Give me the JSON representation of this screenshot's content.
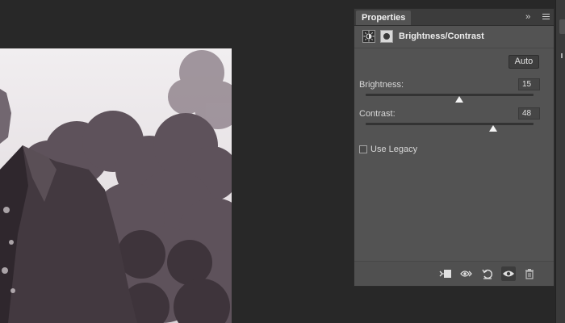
{
  "panel": {
    "tab_label": "Properties",
    "collapse_glyph": "››",
    "adjustment_title": "Brightness/Contrast",
    "auto_label": "Auto",
    "brightness": {
      "label": "Brightness:",
      "value": "15",
      "fraction": 0.56
    },
    "contrast": {
      "label": "Contrast:",
      "value": "48",
      "fraction": 0.76
    },
    "legacy": {
      "label": "Use Legacy",
      "checked": false
    },
    "footer_icons": [
      "clip-to-layer-icon",
      "view-previous-state-icon",
      "reset-icon",
      "visibility-eye-icon",
      "trash-icon"
    ]
  },
  "colors": {
    "panel_bg": "#535353",
    "workspace_bg": "#282828",
    "thumb": "#f4f4f4"
  }
}
